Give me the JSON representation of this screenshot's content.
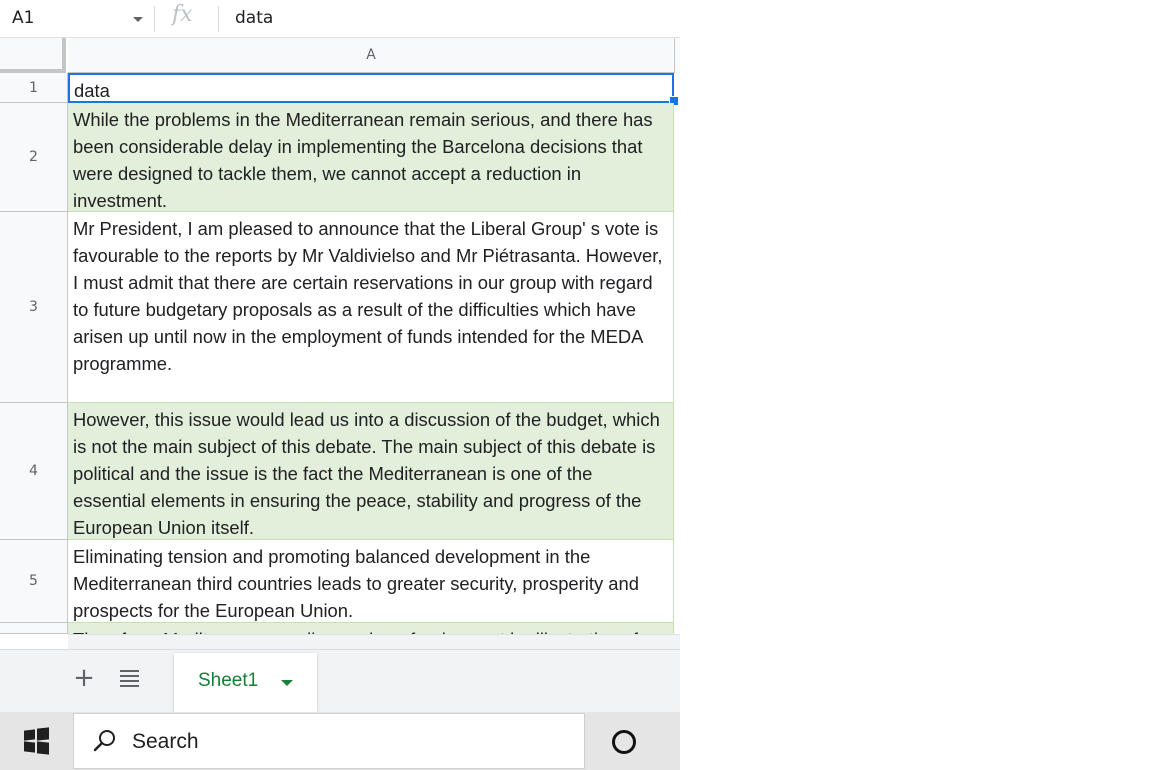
{
  "formula_bar": {
    "name_box": "A1",
    "fx_label": "fx",
    "value": "data"
  },
  "columns": [
    "A"
  ],
  "rows": [
    {
      "num": "1",
      "text": "data"
    },
    {
      "num": "2",
      "text": "While the problems in the Mediterranean remain serious, and there has been considerable delay in implementing the Barcelona decisions that were designed to tackle them, we cannot accept a reduction in investment."
    },
    {
      "num": "3",
      "text": "Mr President, I am pleased to announce that the Liberal Group' s vote is favourable to the reports by Mr Valdivielso and Mr Piétrasanta. However, I must admit that there are certain reservations in our group with regard to future budgetary proposals as a result of the difficulties which have arisen up until now in the employment of funds intended for the MEDA programme."
    },
    {
      "num": "4",
      "text": "However, this issue would lead us into a discussion of the budget, which is not the main subject of this debate. The main subject of this debate is political and the issue is the fact the Mediterranean is one of the essential elements in ensuring the peace, stability and progress of the European Union itself."
    },
    {
      "num": "5",
      "text": "Eliminating tension and promoting balanced development in the Mediterranean third countries leads to greater security, prosperity and prospects for the European Union."
    },
    {
      "num": "",
      "text": "Therefore, Mediterranean policy, and our funds, must be illustrative of"
    }
  ],
  "sheet_tabs": {
    "active": "Sheet1"
  },
  "taskbar": {
    "search_placeholder": "Search"
  }
}
